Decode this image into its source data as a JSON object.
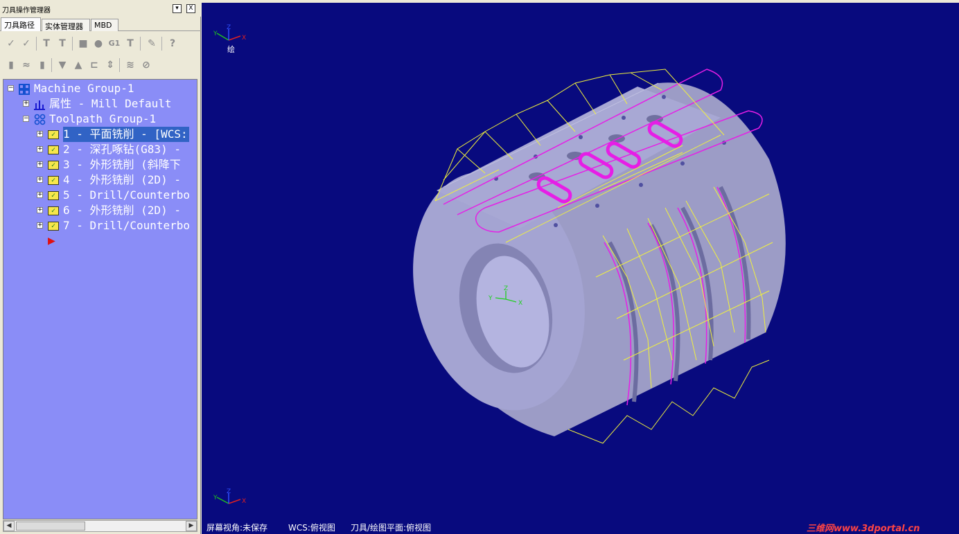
{
  "panel": {
    "title": "刀具操作管理器",
    "dropdown_glyph": "▾",
    "close_glyph": "X"
  },
  "tabs": [
    {
      "label": "刀具路径"
    },
    {
      "label": "实体管理器"
    },
    {
      "label": "MBD"
    }
  ],
  "tree": {
    "machine_group": "Machine Group-1",
    "properties": "属性 - Mill Default",
    "toolpath_group": "Toolpath Group-1",
    "operations": [
      {
        "label": "1 - 平面铣削 - [WCS:",
        "selected": true
      },
      {
        "label": "2 - 深孔啄钻(G83) -",
        "selected": false
      },
      {
        "label": "3 - 外形铣削 (斜降下",
        "selected": false
      },
      {
        "label": "4 - 外形铣削 (2D) -",
        "selected": false
      },
      {
        "label": "5 - Drill/Counterbo",
        "selected": false
      },
      {
        "label": "6 - 外形铣削 (2D) -",
        "selected": false
      },
      {
        "label": "7 - Drill/Counterbo",
        "selected": false
      }
    ],
    "insert_arrow": "▶"
  },
  "viewport": {
    "axis_top_label": "绘",
    "axis_x": "X",
    "axis_y": "Y",
    "axis_z": "Z"
  },
  "status": {
    "screen_view": "屏幕视角:未保存",
    "wcs": "WCS:俯视图",
    "tool_plane": "刀具/绘图平面:俯视图"
  },
  "brand": "三维网www.3dportal.cn",
  "colors": {
    "background": "#080a7e",
    "tree_bg": "#8a8df7",
    "part": "#9c9cc6",
    "toolpath_yellow": "#f2f23c",
    "toolpath_magenta": "#e61ee6"
  }
}
